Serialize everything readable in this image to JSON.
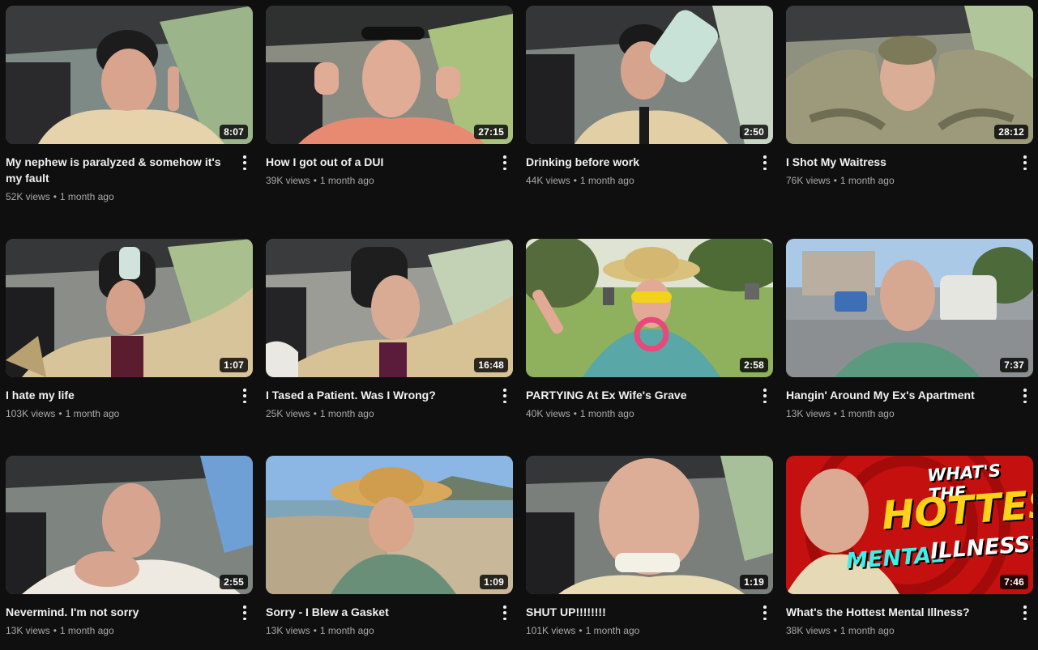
{
  "videos": [
    {
      "title": "My nephew is paralyzed & somehow it's my fault",
      "views": "52K views",
      "age": "1 month ago",
      "duration": "8:07",
      "scene": "car"
    },
    {
      "title": "How I got out of a DUI",
      "views": "39K views",
      "age": "1 month ago",
      "duration": "27:15",
      "scene": "car"
    },
    {
      "title": "Drinking before work",
      "views": "44K views",
      "age": "1 month ago",
      "duration": "2:50",
      "scene": "car"
    },
    {
      "title": "I Shot My Waitress",
      "views": "76K views",
      "age": "1 month ago",
      "duration": "28:12",
      "scene": "car-camo"
    },
    {
      "title": "I hate my life",
      "views": "103K views",
      "age": "1 month ago",
      "duration": "1:07",
      "scene": "car"
    },
    {
      "title": "I Tased a Patient. Was I Wrong?",
      "views": "25K views",
      "age": "1 month ago",
      "duration": "16:48",
      "scene": "car"
    },
    {
      "title": "PARTYING At Ex Wife's Grave",
      "views": "40K views",
      "age": "1 month ago",
      "duration": "2:58",
      "scene": "cemetery"
    },
    {
      "title": "Hangin' Around My Ex's Apartment",
      "views": "13K views",
      "age": "1 month ago",
      "duration": "7:37",
      "scene": "street"
    },
    {
      "title": "Nevermind. I'm not sorry",
      "views": "13K views",
      "age": "1 month ago",
      "duration": "2:55",
      "scene": "car"
    },
    {
      "title": "Sorry - I Blew a Gasket",
      "views": "13K views",
      "age": "1 month ago",
      "duration": "1:09",
      "scene": "beach"
    },
    {
      "title": "SHUT UP!!!!!!!!",
      "views": "101K views",
      "age": "1 month ago",
      "duration": "1:19",
      "scene": "car"
    },
    {
      "title": "What's the Hottest Mental Illness?",
      "views": "38K views",
      "age": "1 month ago",
      "duration": "7:46",
      "scene": "red-graphic",
      "thumb_text": [
        "WHAT'S THE",
        "HOTTEST",
        "MENTAL",
        "ILLNESS?"
      ]
    }
  ],
  "colors": {
    "background": "#0f0f0f",
    "title": "#f1f1f1",
    "meta": "#aaaaaa",
    "red_bg": "#c4100e",
    "yellow_text": "#ffd21a",
    "cyan_text": "#3ff0e8"
  },
  "icons": {
    "menu": "more-vert-icon"
  }
}
